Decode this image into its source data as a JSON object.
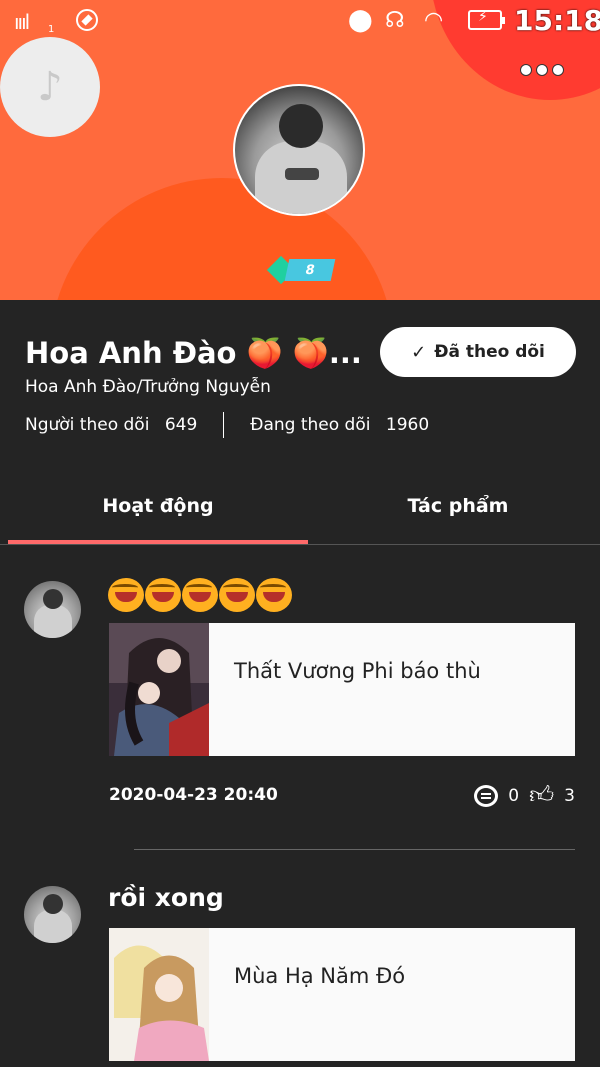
{
  "status_bar": {
    "signal_sub": "1",
    "time": "15:18",
    "icons": [
      "signal-icon",
      "compass-icon",
      "location-icon",
      "headset-icon",
      "wifi-icon",
      "battery-charging-icon"
    ]
  },
  "profile": {
    "name": "Hoa Anh Đào 🍑 🍑...",
    "subname": "Hoa Anh Đào/Trưởng Nguyễn",
    "follow_button": "Đã theo dõi",
    "followers_label": "Người theo dõi",
    "followers_count": "649",
    "following_label": "Đang theo dõi",
    "following_count": "1960",
    "badge_text": "8"
  },
  "tabs": [
    {
      "label": "Hoạt động",
      "active": true
    },
    {
      "label": "Tác phẩm",
      "active": false
    }
  ],
  "posts": [
    {
      "text_emojis": 5,
      "card_title": "Thất Vương Phi báo thù",
      "timestamp": "2020-04-23 20:40",
      "comments": "0",
      "likes": "3"
    },
    {
      "text": "rồi xong",
      "card_title": "Mùa Hạ Năm Đó"
    }
  ],
  "colors": {
    "header_bg": "#ff6a3d",
    "dome": "#ff5a1f",
    "page_bg": "#242424",
    "tab_accent": "#ff6a6a"
  }
}
